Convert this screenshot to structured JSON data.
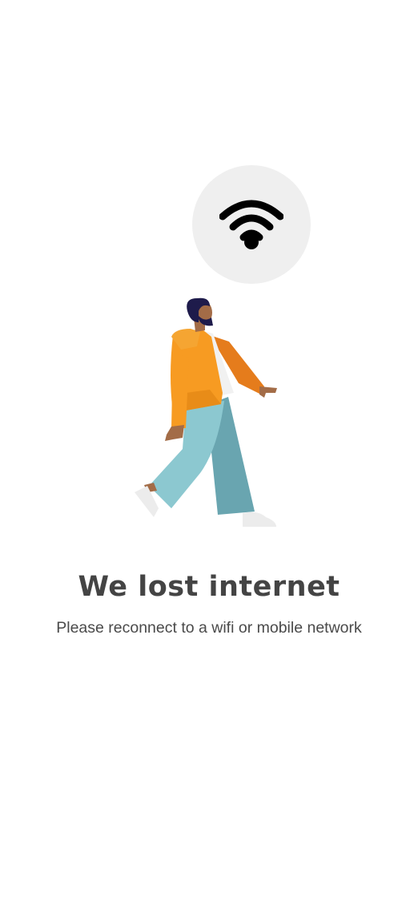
{
  "offline_screen": {
    "title": "We lost internet",
    "subtitle": "Please reconnect to a wifi or mobile network",
    "icon": "wifi-icon",
    "illustration": "walking-person-illustration"
  },
  "colors": {
    "background": "#ffffff",
    "bubble": "#efefef",
    "icon": "#000000",
    "title_text": "#444444",
    "subtitle_text": "#4a4a4a",
    "jacket": "#f79b22",
    "pants": "#8cc8d0",
    "hair": "#1e1b4b"
  }
}
